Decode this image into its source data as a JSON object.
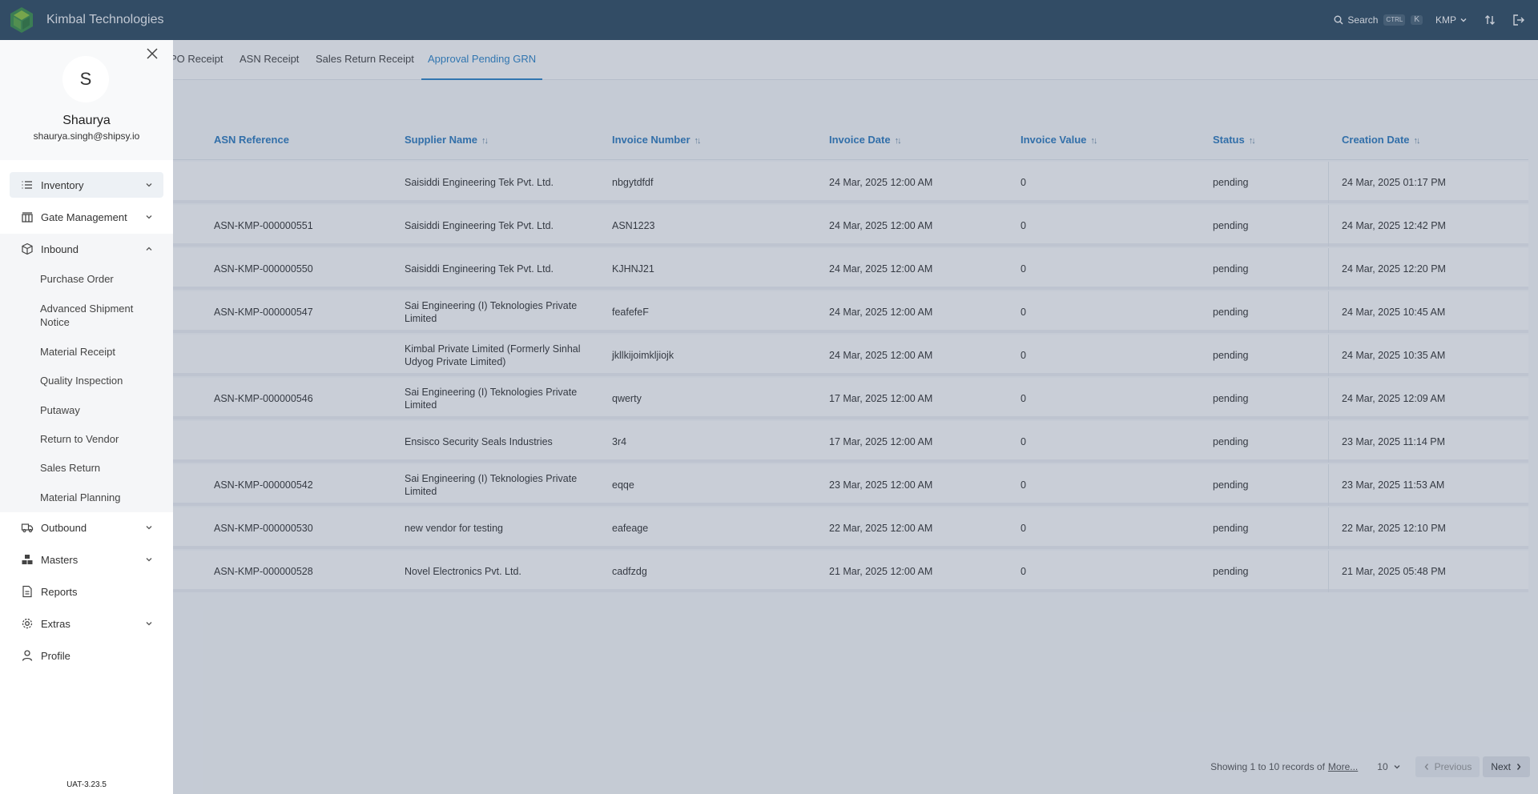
{
  "header": {
    "brand": "Kimbal Technologies",
    "search_label": "Search",
    "kbd_ctrl": "CTRL",
    "kbd_k": "K",
    "org": "KMP"
  },
  "tabs": [
    {
      "label": "PO Receipt",
      "active": false
    },
    {
      "label": "ASN Receipt",
      "active": false
    },
    {
      "label": "Sales Return Receipt",
      "active": false
    },
    {
      "label": "Approval Pending GRN",
      "active": true
    }
  ],
  "table": {
    "columns": [
      "ASN Reference",
      "Supplier Name",
      "Invoice Number",
      "Invoice Date",
      "Invoice Value",
      "Status",
      "Creation Date"
    ],
    "rows": [
      {
        "asn": "",
        "supplier": "Saisiddi Engineering Tek Pvt. Ltd.",
        "invoice_no": "nbgytdfdf",
        "invoice_date": "24 Mar, 2025 12:00 AM",
        "value": "0",
        "status": "pending",
        "created": "24 Mar, 2025 01:17 PM"
      },
      {
        "asn": "ASN-KMP-000000551",
        "supplier": "Saisiddi Engineering Tek Pvt. Ltd.",
        "invoice_no": "ASN1223",
        "invoice_date": "24 Mar, 2025 12:00 AM",
        "value": "0",
        "status": "pending",
        "created": "24 Mar, 2025 12:42 PM"
      },
      {
        "asn": "ASN-KMP-000000550",
        "supplier": "Saisiddi Engineering Tek Pvt. Ltd.",
        "invoice_no": "KJHNJ21",
        "invoice_date": "24 Mar, 2025 12:00 AM",
        "value": "0",
        "status": "pending",
        "created": "24 Mar, 2025 12:20 PM"
      },
      {
        "asn": "ASN-KMP-000000547",
        "supplier": "Sai Engineering (I) Teknologies Private Limited",
        "invoice_no": "feafefeF",
        "invoice_date": "24 Mar, 2025 12:00 AM",
        "value": "0",
        "status": "pending",
        "created": "24 Mar, 2025 10:45 AM"
      },
      {
        "asn": "",
        "supplier": "Kimbal Private Limited (Formerly Sinhal Udyog Private Limited)",
        "invoice_no": "jkllkijoimkljiojk",
        "invoice_date": "24 Mar, 2025 12:00 AM",
        "value": "0",
        "status": "pending",
        "created": "24 Mar, 2025 10:35 AM"
      },
      {
        "asn": "ASN-KMP-000000546",
        "supplier": "Sai Engineering (I) Teknologies Private Limited",
        "invoice_no": "qwerty",
        "invoice_date": "17 Mar, 2025 12:00 AM",
        "value": "0",
        "status": "pending",
        "created": "24 Mar, 2025 12:09 AM"
      },
      {
        "asn": "",
        "supplier": "Ensisco Security Seals Industries",
        "invoice_no": "3r4",
        "invoice_date": "17 Mar, 2025 12:00 AM",
        "value": "0",
        "status": "pending",
        "created": "23 Mar, 2025 11:14 PM"
      },
      {
        "asn": "ASN-KMP-000000542",
        "supplier": "Sai Engineering (I) Teknologies Private Limited",
        "invoice_no": "eqqe",
        "invoice_date": "23 Mar, 2025 12:00 AM",
        "value": "0",
        "status": "pending",
        "created": "23 Mar, 2025 11:53 AM"
      },
      {
        "asn": "ASN-KMP-000000530",
        "supplier": "new vendor for testing",
        "invoice_no": "eafeage",
        "invoice_date": "22 Mar, 2025 12:00 AM",
        "value": "0",
        "status": "pending",
        "created": "22 Mar, 2025 12:10 PM"
      },
      {
        "asn": "ASN-KMP-000000528",
        "supplier": "Novel Electronics Pvt. Ltd.",
        "invoice_no": "cadfzdg",
        "invoice_date": "21 Mar, 2025 12:00 AM",
        "value": "0",
        "status": "pending",
        "created": "21 Mar, 2025 05:48 PM"
      }
    ]
  },
  "pagination": {
    "summary": "Showing 1 to 10 records of",
    "more": "More...",
    "page_size": "10",
    "prev": "Previous",
    "next": "Next"
  },
  "drawer": {
    "avatar_initial": "S",
    "user_name": "Shaurya",
    "user_email": "shaurya.singh@shipsy.io",
    "nav": {
      "inventory": "Inventory",
      "gate": "Gate Management",
      "inbound": "Inbound",
      "outbound": "Outbound",
      "masters": "Masters",
      "reports": "Reports",
      "extras": "Extras",
      "profile": "Profile"
    },
    "inbound_items": [
      "Purchase Order",
      "Advanced Shipment Notice",
      "Material Receipt",
      "Quality Inspection",
      "Putaway",
      "Return to Vendor",
      "Sales Return",
      "Material Planning"
    ],
    "version": "UAT-3.23.5"
  },
  "colors": {
    "header_bg": "#2f4b62",
    "accent": "#2e86c9",
    "overlay": "rgba(60,80,110,0.28)"
  }
}
